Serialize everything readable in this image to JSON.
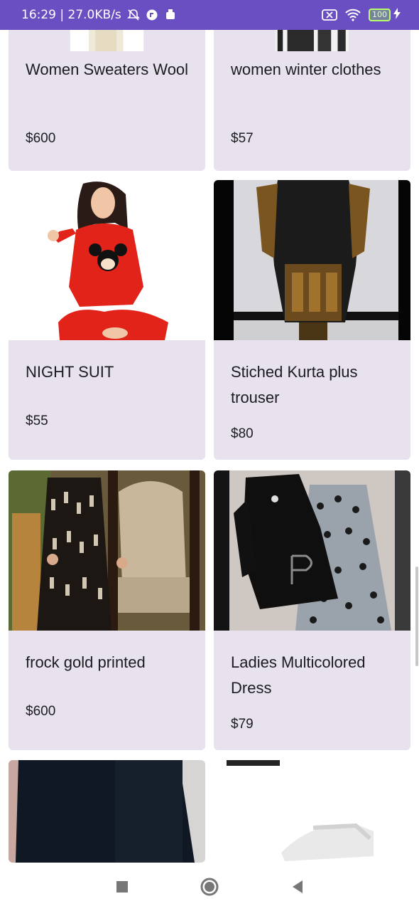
{
  "status_bar": {
    "time_speed": "16:29 | 27.0KB/s",
    "battery": "100",
    "bg_color": "#6a4fc3"
  },
  "products": [
    {
      "name": "Women Sweaters Wool",
      "price": "$600"
    },
    {
      "name": "women winter clothes",
      "price": "$57"
    },
    {
      "name": "NIGHT SUIT",
      "price": "$55"
    },
    {
      "name": "Stiched Kurta plus trouser",
      "price": "$80"
    },
    {
      "name": "frock gold printed",
      "price": "$600"
    },
    {
      "name": "Ladies Multicolored Dress",
      "price": "$79"
    }
  ],
  "card_color": "#e8e2ef",
  "nav": {
    "recents": "square-icon",
    "home": "circle-icon",
    "back": "triangle-back-icon"
  }
}
